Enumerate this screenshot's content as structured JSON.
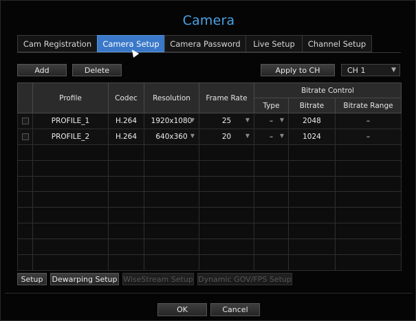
{
  "window": {
    "title": "Camera"
  },
  "tabs": [
    {
      "label": "Cam Registration",
      "active": false
    },
    {
      "label": "Camera Setup",
      "active": true
    },
    {
      "label": "Camera Password",
      "active": false
    },
    {
      "label": "Live Setup",
      "active": false
    },
    {
      "label": "Channel Setup",
      "active": false
    }
  ],
  "toolbar": {
    "add_label": "Add",
    "delete_label": "Delete",
    "apply_label": "Apply to CH",
    "channel_select": {
      "value": "CH 1"
    }
  },
  "table": {
    "headers": {
      "profile": "Profile",
      "codec": "Codec",
      "resolution": "Resolution",
      "frame_rate": "Frame Rate",
      "bitrate_control": "Bitrate Control",
      "type": "Type",
      "bitrate": "Bitrate",
      "bitrate_range": "Bitrate Range"
    },
    "rows": [
      {
        "profile": "PROFILE_1",
        "codec": "H.264",
        "resolution": "1920x1080",
        "frame_rate": "25",
        "type": "–",
        "bitrate": "2048",
        "bitrate_range": "–"
      },
      {
        "profile": "PROFILE_2",
        "codec": "H.264",
        "resolution": "640x360",
        "frame_rate": "20",
        "type": "–",
        "bitrate": "1024",
        "bitrate_range": "–"
      }
    ]
  },
  "footer_buttons": {
    "setup": "Setup",
    "dewarping": "Dewarping Setup",
    "wisestream": "WiseStream Setup",
    "dynamic_gov": "Dynamic GOV/FPS Setup"
  },
  "dialog": {
    "ok": "OK",
    "cancel": "Cancel"
  },
  "colors": {
    "accent": "#3a78c9",
    "title": "#4aa3e6"
  }
}
